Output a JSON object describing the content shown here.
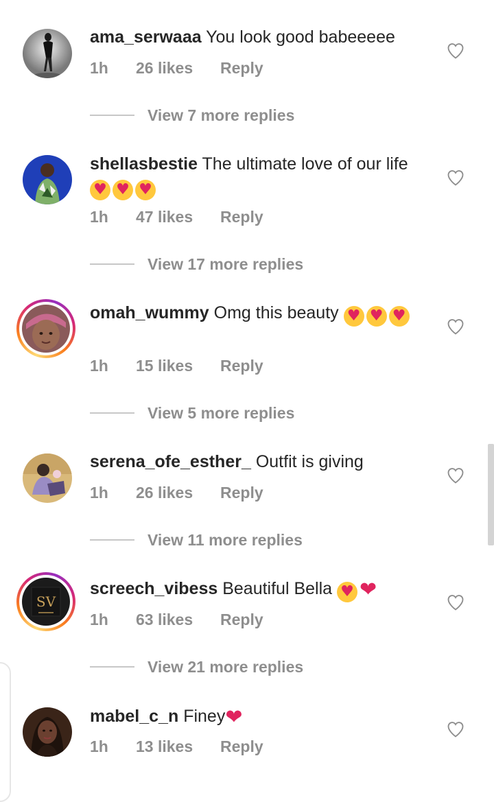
{
  "comments": [
    {
      "username": "ama_serwaaa",
      "text": "You look good babeeeee",
      "emojis": [],
      "time": "1h",
      "likes": "26 likes",
      "reply": "Reply",
      "view_replies": "View 7 more replies",
      "story_ring": false
    },
    {
      "username": "shellasbestie",
      "text": "The ultimate love of our life",
      "emojis": [
        "heart-eyes",
        "heart-eyes",
        "heart-eyes"
      ],
      "time": "1h",
      "likes": "47 likes",
      "reply": "Reply",
      "view_replies": "View 17 more replies",
      "story_ring": false
    },
    {
      "username": "omah_wummy",
      "text": "Omg this beauty",
      "emojis": [
        "heart-eyes",
        "heart-eyes",
        "heart-eyes"
      ],
      "time": "1h",
      "likes": "15 likes",
      "reply": "Reply",
      "view_replies": "View 5 more replies",
      "story_ring": true
    },
    {
      "username": "serena_ofe_esther_",
      "text": "Outfit is giving",
      "emojis": [],
      "time": "1h",
      "likes": "26 likes",
      "reply": "Reply",
      "view_replies": "View 11 more replies",
      "story_ring": false
    },
    {
      "username": "screech_vibess",
      "text": "Beautiful Bella",
      "emojis": [
        "heart-eyes",
        "red-heart"
      ],
      "time": "1h",
      "likes": "63 likes",
      "reply": "Reply",
      "view_replies": "View 21 more replies",
      "story_ring": true
    },
    {
      "username": "mabel_c_n",
      "text": "Finey",
      "emojis": [
        "red-heart"
      ],
      "time": "1h",
      "likes": "13 likes",
      "reply": "Reply",
      "view_replies": "",
      "story_ring": false
    }
  ],
  "colors": {
    "text": "#262626",
    "meta": "#8e8e8e",
    "divider": "#c7c7c7",
    "heart": "#e0245e"
  },
  "icons": {
    "like": "heart-outline-icon",
    "emoji_heart_eyes": "heart-eyes-emoji",
    "emoji_red_heart": "red-heart-emoji"
  }
}
